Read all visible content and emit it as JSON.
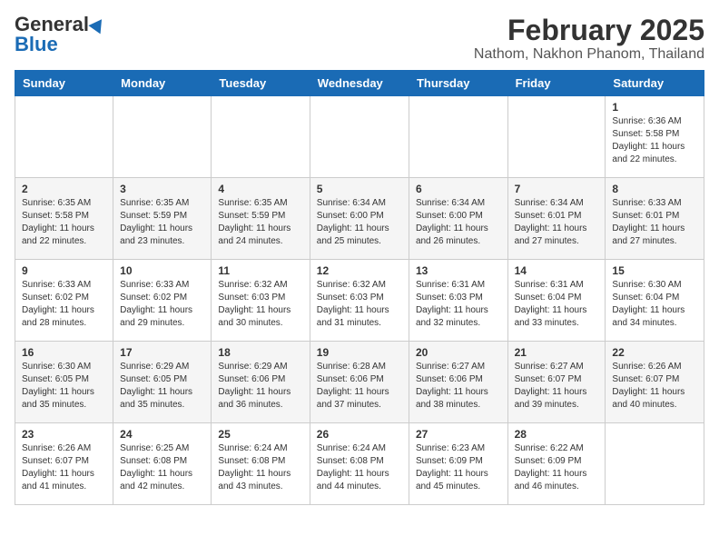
{
  "header": {
    "logo_line1": "General",
    "logo_line2": "Blue",
    "title": "February 2025",
    "subtitle": "Nathom, Nakhon Phanom, Thailand"
  },
  "weekdays": [
    "Sunday",
    "Monday",
    "Tuesday",
    "Wednesday",
    "Thursday",
    "Friday",
    "Saturday"
  ],
  "weeks": [
    [
      {
        "day": "",
        "info": ""
      },
      {
        "day": "",
        "info": ""
      },
      {
        "day": "",
        "info": ""
      },
      {
        "day": "",
        "info": ""
      },
      {
        "day": "",
        "info": ""
      },
      {
        "day": "",
        "info": ""
      },
      {
        "day": "1",
        "info": "Sunrise: 6:36 AM\nSunset: 5:58 PM\nDaylight: 11 hours\nand 22 minutes."
      }
    ],
    [
      {
        "day": "2",
        "info": "Sunrise: 6:35 AM\nSunset: 5:58 PM\nDaylight: 11 hours\nand 22 minutes."
      },
      {
        "day": "3",
        "info": "Sunrise: 6:35 AM\nSunset: 5:59 PM\nDaylight: 11 hours\nand 23 minutes."
      },
      {
        "day": "4",
        "info": "Sunrise: 6:35 AM\nSunset: 5:59 PM\nDaylight: 11 hours\nand 24 minutes."
      },
      {
        "day": "5",
        "info": "Sunrise: 6:34 AM\nSunset: 6:00 PM\nDaylight: 11 hours\nand 25 minutes."
      },
      {
        "day": "6",
        "info": "Sunrise: 6:34 AM\nSunset: 6:00 PM\nDaylight: 11 hours\nand 26 minutes."
      },
      {
        "day": "7",
        "info": "Sunrise: 6:34 AM\nSunset: 6:01 PM\nDaylight: 11 hours\nand 27 minutes."
      },
      {
        "day": "8",
        "info": "Sunrise: 6:33 AM\nSunset: 6:01 PM\nDaylight: 11 hours\nand 27 minutes."
      }
    ],
    [
      {
        "day": "9",
        "info": "Sunrise: 6:33 AM\nSunset: 6:02 PM\nDaylight: 11 hours\nand 28 minutes."
      },
      {
        "day": "10",
        "info": "Sunrise: 6:33 AM\nSunset: 6:02 PM\nDaylight: 11 hours\nand 29 minutes."
      },
      {
        "day": "11",
        "info": "Sunrise: 6:32 AM\nSunset: 6:03 PM\nDaylight: 11 hours\nand 30 minutes."
      },
      {
        "day": "12",
        "info": "Sunrise: 6:32 AM\nSunset: 6:03 PM\nDaylight: 11 hours\nand 31 minutes."
      },
      {
        "day": "13",
        "info": "Sunrise: 6:31 AM\nSunset: 6:03 PM\nDaylight: 11 hours\nand 32 minutes."
      },
      {
        "day": "14",
        "info": "Sunrise: 6:31 AM\nSunset: 6:04 PM\nDaylight: 11 hours\nand 33 minutes."
      },
      {
        "day": "15",
        "info": "Sunrise: 6:30 AM\nSunset: 6:04 PM\nDaylight: 11 hours\nand 34 minutes."
      }
    ],
    [
      {
        "day": "16",
        "info": "Sunrise: 6:30 AM\nSunset: 6:05 PM\nDaylight: 11 hours\nand 35 minutes."
      },
      {
        "day": "17",
        "info": "Sunrise: 6:29 AM\nSunset: 6:05 PM\nDaylight: 11 hours\nand 35 minutes."
      },
      {
        "day": "18",
        "info": "Sunrise: 6:29 AM\nSunset: 6:06 PM\nDaylight: 11 hours\nand 36 minutes."
      },
      {
        "day": "19",
        "info": "Sunrise: 6:28 AM\nSunset: 6:06 PM\nDaylight: 11 hours\nand 37 minutes."
      },
      {
        "day": "20",
        "info": "Sunrise: 6:27 AM\nSunset: 6:06 PM\nDaylight: 11 hours\nand 38 minutes."
      },
      {
        "day": "21",
        "info": "Sunrise: 6:27 AM\nSunset: 6:07 PM\nDaylight: 11 hours\nand 39 minutes."
      },
      {
        "day": "22",
        "info": "Sunrise: 6:26 AM\nSunset: 6:07 PM\nDaylight: 11 hours\nand 40 minutes."
      }
    ],
    [
      {
        "day": "23",
        "info": "Sunrise: 6:26 AM\nSunset: 6:07 PM\nDaylight: 11 hours\nand 41 minutes."
      },
      {
        "day": "24",
        "info": "Sunrise: 6:25 AM\nSunset: 6:08 PM\nDaylight: 11 hours\nand 42 minutes."
      },
      {
        "day": "25",
        "info": "Sunrise: 6:24 AM\nSunset: 6:08 PM\nDaylight: 11 hours\nand 43 minutes."
      },
      {
        "day": "26",
        "info": "Sunrise: 6:24 AM\nSunset: 6:08 PM\nDaylight: 11 hours\nand 44 minutes."
      },
      {
        "day": "27",
        "info": "Sunrise: 6:23 AM\nSunset: 6:09 PM\nDaylight: 11 hours\nand 45 minutes."
      },
      {
        "day": "28",
        "info": "Sunrise: 6:22 AM\nSunset: 6:09 PM\nDaylight: 11 hours\nand 46 minutes."
      },
      {
        "day": "",
        "info": ""
      }
    ]
  ]
}
